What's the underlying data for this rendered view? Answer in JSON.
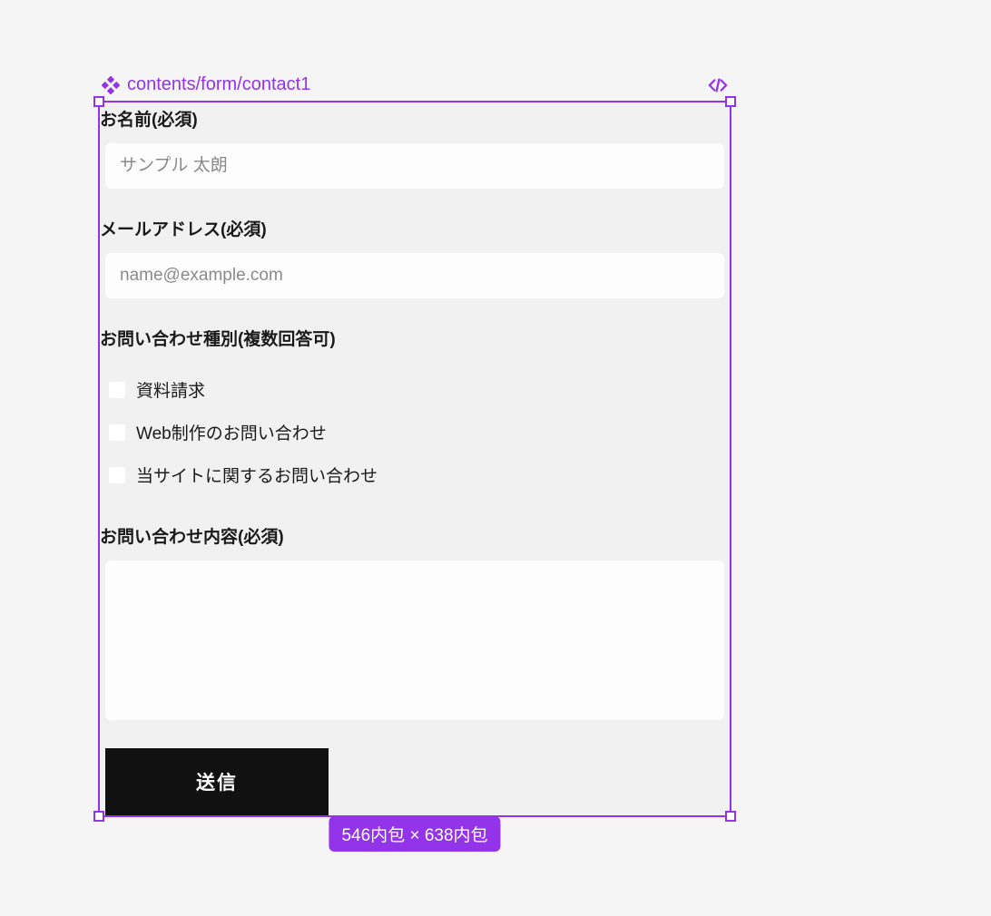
{
  "header": {
    "component_path": "contents/form/contact1"
  },
  "form": {
    "name": {
      "label": "お名前(必須)",
      "placeholder": "サンプル 太朗",
      "value": ""
    },
    "email": {
      "label": "メールアドレス(必須)",
      "placeholder": "name@example.com",
      "value": ""
    },
    "inquiry_type": {
      "label": "お問い合わせ種別(複数回答可)",
      "options": [
        {
          "label": "資料請求",
          "checked": false
        },
        {
          "label": "Web制作のお問い合わせ",
          "checked": false
        },
        {
          "label": "当サイトに関するお問い合わせ",
          "checked": false
        }
      ]
    },
    "message": {
      "label": "お問い合わせ内容(必須)",
      "value": ""
    },
    "submit_label": "送信"
  },
  "dimensions": {
    "width": "546",
    "width_unit": "内包",
    "sep": " × ",
    "height": "638",
    "height_unit": "内包"
  },
  "colors": {
    "accent": "#9333ea",
    "button_bg": "#111111"
  }
}
